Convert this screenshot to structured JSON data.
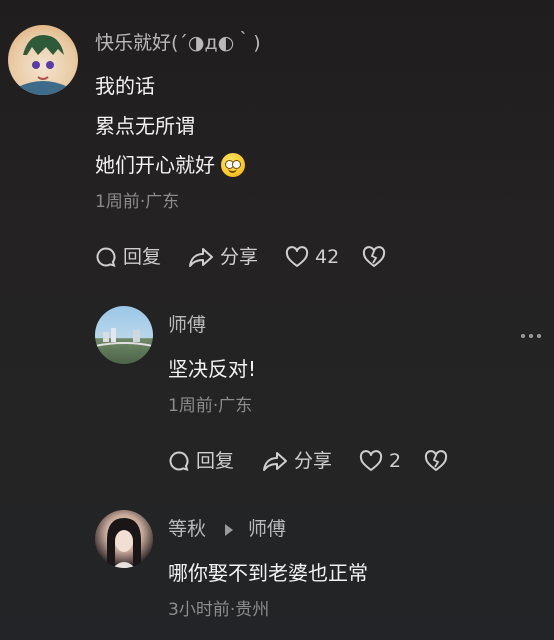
{
  "comments": [
    {
      "username": "快乐就好(´◑д◐｀)",
      "lines": [
        "我的话",
        "累点无所谓",
        "她们开心就好"
      ],
      "emoji": "smiling-face",
      "meta": "1周前·广东",
      "actions": {
        "reply": "回复",
        "share": "分享",
        "likes": "42"
      }
    },
    {
      "username": "师傅",
      "text": "坚决反对!",
      "meta": "1周前·广东",
      "actions": {
        "reply": "回复",
        "share": "分享",
        "likes": "2"
      }
    },
    {
      "username": "等秋",
      "reply_to": "师傅",
      "text": "哪你娶不到老婆也正常",
      "meta": "3小时前·贵州"
    }
  ],
  "colors": {
    "background": "#232222",
    "name": "#b9b9b9",
    "meta": "#8c8c8c",
    "text": "#f2f2f2"
  }
}
